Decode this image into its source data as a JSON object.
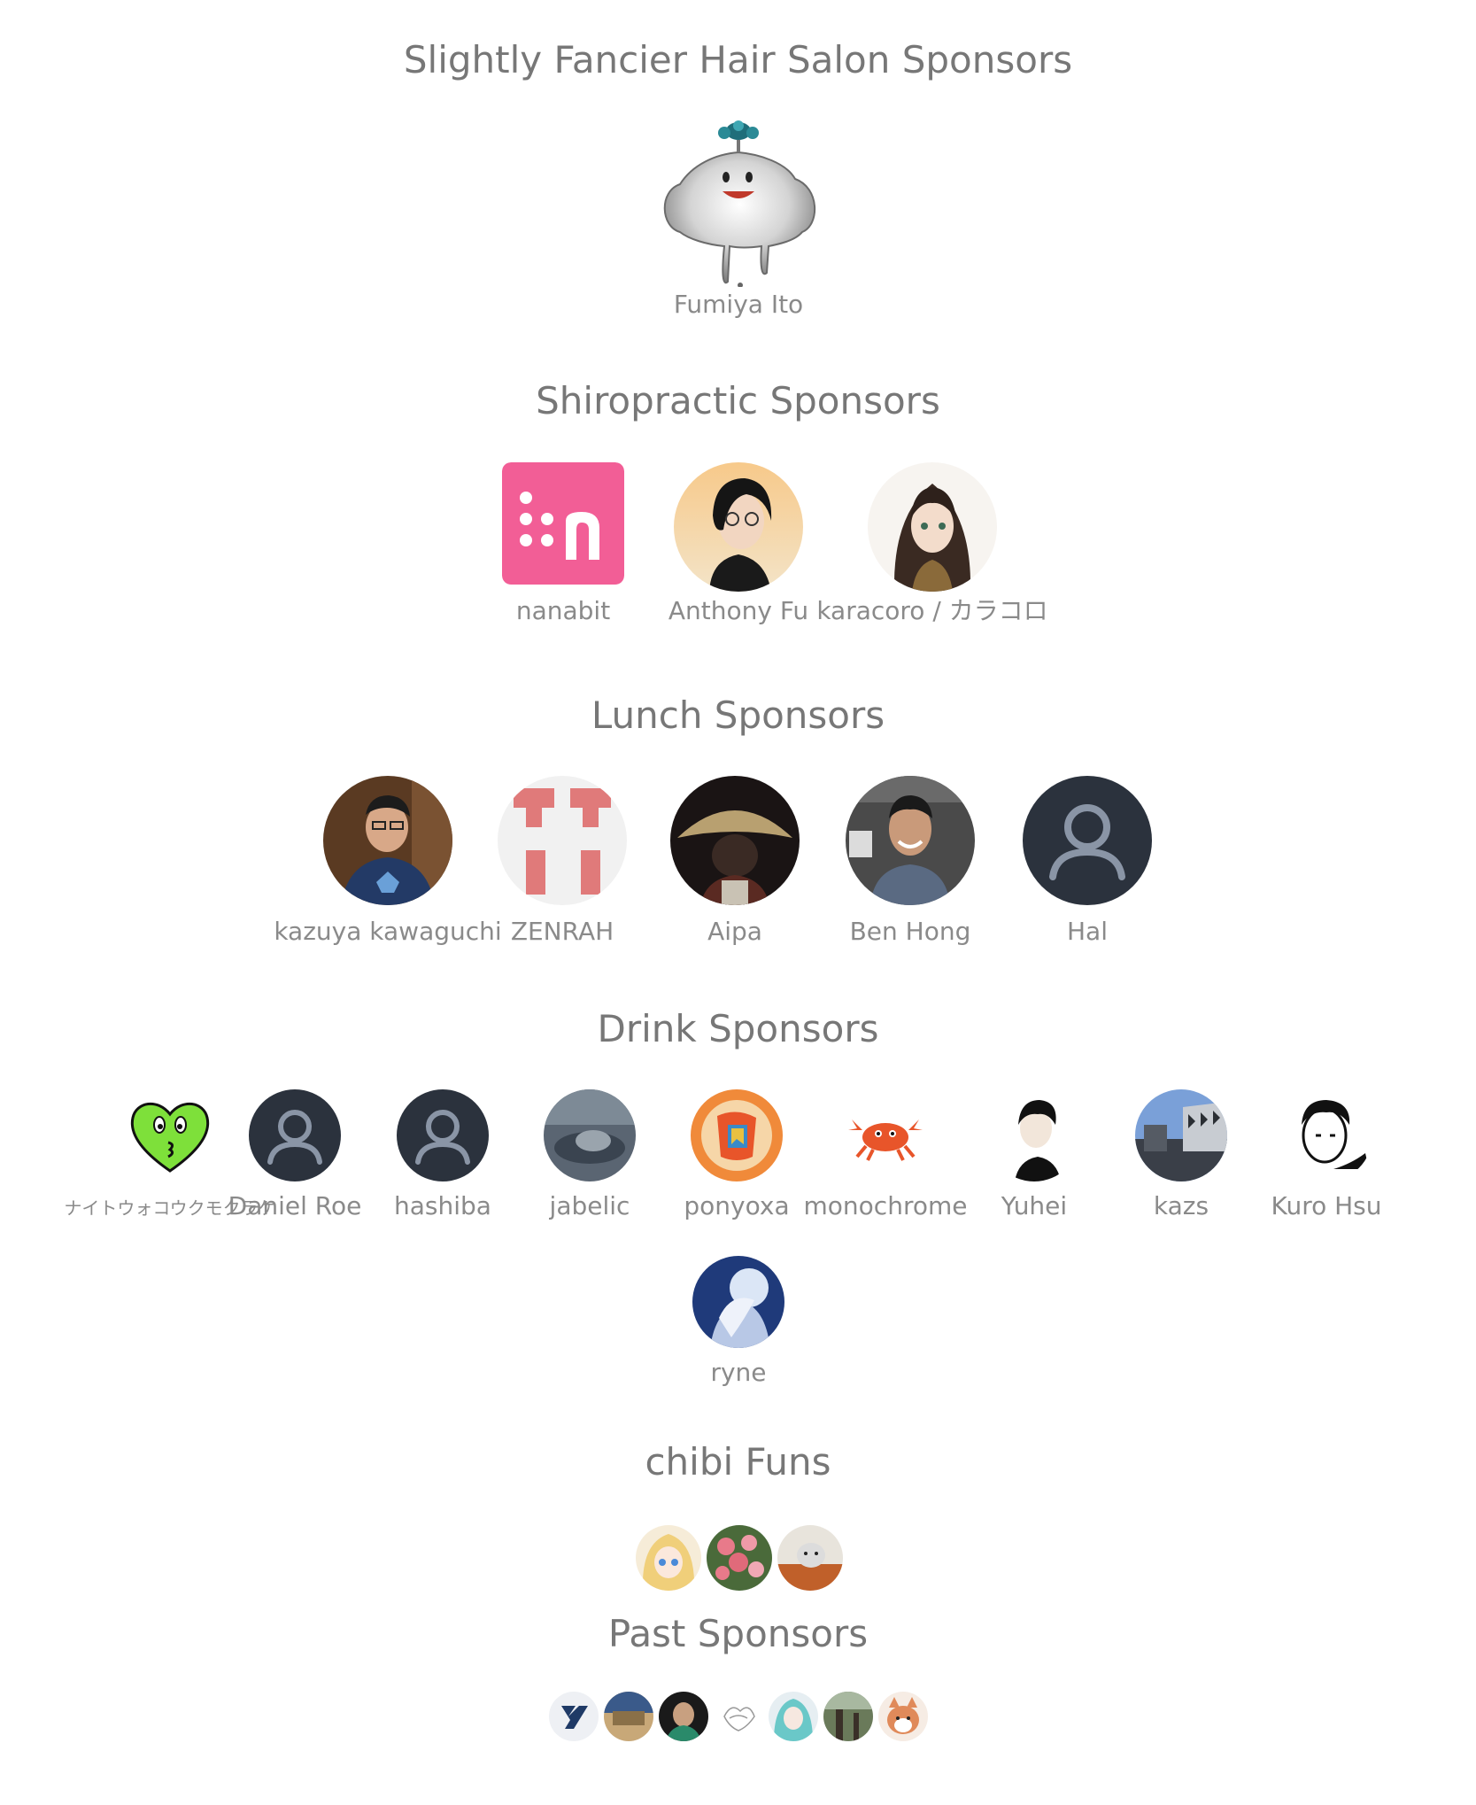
{
  "tiers": {
    "fancier": {
      "title": "Slightly Fancier Hair Salon Sponsors",
      "sponsors": [
        {
          "name": "Fumiya Ito",
          "avatar_icon": "metal-slime-icon"
        }
      ]
    },
    "shiropractic": {
      "title": "Shiropractic Sponsors",
      "sponsors": [
        {
          "name": "nanabit",
          "avatar_icon": "nanabit-logo-icon",
          "color": "#f25e96"
        },
        {
          "name": "Anthony Fu",
          "avatar_icon": "anime-portrait-icon"
        },
        {
          "name": "karacoro / カラコロ",
          "avatar_icon": "anime-girl-icon"
        }
      ]
    },
    "lunch": {
      "title": "Lunch Sponsors",
      "sponsors": [
        {
          "name": "kazuya kawaguchi",
          "avatar_icon": "person-photo-icon"
        },
        {
          "name": "ZENRAH",
          "avatar_icon": "zenrah-logo-icon",
          "color": "#e07a7a"
        },
        {
          "name": "Aipa",
          "avatar_icon": "straw-hat-icon"
        },
        {
          "name": "Ben Hong",
          "avatar_icon": "person-photo-icon"
        },
        {
          "name": "Hal",
          "avatar_icon": "default-user-icon"
        }
      ]
    },
    "drink": {
      "title": "Drink Sponsors",
      "sponsors": [
        {
          "name": "ナイトウォコウクモクラケ",
          "avatar_icon": "green-heart-icon",
          "color": "#7ee03a"
        },
        {
          "name": "Daniel Roe",
          "avatar_icon": "default-user-icon"
        },
        {
          "name": "hashiba",
          "avatar_icon": "default-user-icon"
        },
        {
          "name": "jabelic",
          "avatar_icon": "cat-photo-icon"
        },
        {
          "name": "ponyoxa",
          "avatar_icon": "illustration-icon",
          "color": "#f08a3a"
        },
        {
          "name": "monochrome",
          "avatar_icon": "crab-icon",
          "color": "#e8552a"
        },
        {
          "name": "Yuhei",
          "avatar_icon": "sketch-portrait-icon"
        },
        {
          "name": "kazs",
          "avatar_icon": "building-photo-icon"
        },
        {
          "name": "Kuro Hsu",
          "avatar_icon": "sketch-portrait-icon"
        }
      ]
    },
    "drink_overflow": {
      "sponsors": [
        {
          "name": "ryne",
          "avatar_icon": "anime-moon-icon"
        }
      ]
    },
    "chibi": {
      "title": "chibi Funs",
      "avatars": [
        "anime-girl-icon",
        "flowers-icon",
        "bowl-icon"
      ]
    },
    "past": {
      "title": "Past Sponsors",
      "avatars": [
        "y-logo-icon",
        "landscape-icon",
        "person-photo-icon",
        "sketch-icon",
        "anime-teal-icon",
        "forest-icon",
        "shiba-icon"
      ]
    }
  }
}
